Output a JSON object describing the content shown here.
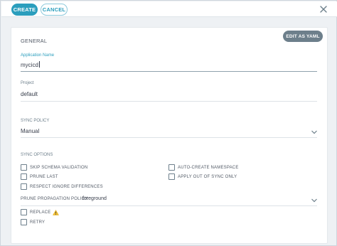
{
  "toolbar": {
    "create_label": "CREATE",
    "cancel_label": "CANCEL",
    "close_icon": "close-icon"
  },
  "general": {
    "section_title": "GENERAL",
    "edit_yaml_label": "EDIT AS YAML",
    "application_name": {
      "label": "Application Name",
      "value": "mycicd"
    },
    "project": {
      "label": "Project",
      "value": "default"
    }
  },
  "sync_policy": {
    "section_title": "SYNC POLICY",
    "selected": "Manual"
  },
  "sync_options": {
    "section_title": "SYNC OPTIONS",
    "left": [
      {
        "label": "SKIP SCHEMA VALIDATION",
        "checked": false
      },
      {
        "label": "PRUNE LAST",
        "checked": false
      },
      {
        "label": "RESPECT IGNORE DIFFERENCES",
        "checked": false
      }
    ],
    "right": [
      {
        "label": "AUTO-CREATE NAMESPACE",
        "checked": false
      },
      {
        "label": "APPLY OUT OF SYNC ONLY",
        "checked": false
      }
    ],
    "prune_propagation": {
      "label": "PRUNE PROPAGATION POLICY:",
      "selected": "foreground"
    },
    "replace": {
      "label": "REPLACE",
      "checked": false,
      "warning_icon": "warning-icon"
    },
    "retry": {
      "label": "RETRY",
      "checked": false
    }
  },
  "colors": {
    "accent": "#2b9ebd",
    "secondary_button": "#6d7f8b",
    "warning": "#f4c030"
  }
}
